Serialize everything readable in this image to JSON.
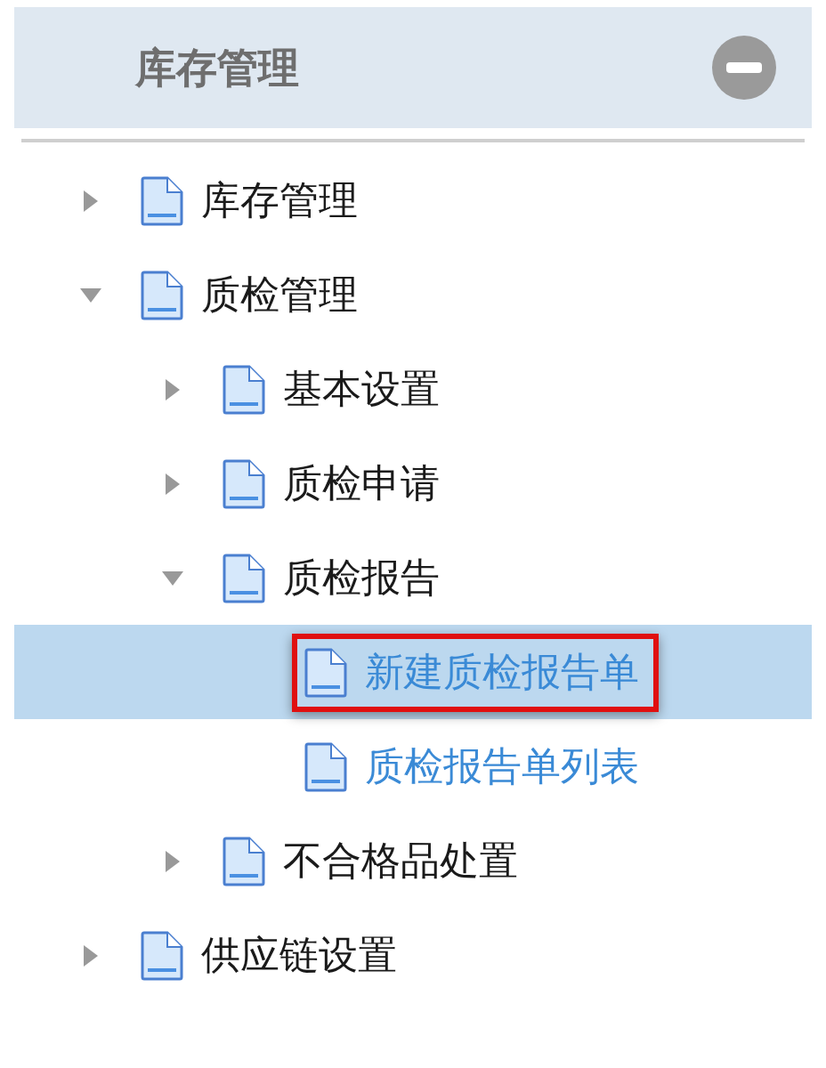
{
  "panel": {
    "title": "库存管理"
  },
  "tree": [
    {
      "label": "库存管理",
      "kind": "branch",
      "expanded": false,
      "selected": false
    },
    {
      "label": "质检管理",
      "kind": "branch",
      "expanded": true,
      "selected": false,
      "children": [
        {
          "label": "基本设置",
          "kind": "branch",
          "expanded": false,
          "selected": false
        },
        {
          "label": "质检申请",
          "kind": "branch",
          "expanded": false,
          "selected": false
        },
        {
          "label": "质检报告",
          "kind": "branch",
          "expanded": true,
          "selected": false,
          "children": [
            {
              "label": "新建质检报告单",
              "kind": "leaf",
              "selected": true
            },
            {
              "label": "质检报告单列表",
              "kind": "leaf",
              "selected": false
            }
          ]
        },
        {
          "label": "不合格品处置",
          "kind": "branch",
          "expanded": false,
          "selected": false
        }
      ]
    },
    {
      "label": "供应链设置",
      "kind": "branch",
      "expanded": false,
      "selected": false
    }
  ]
}
